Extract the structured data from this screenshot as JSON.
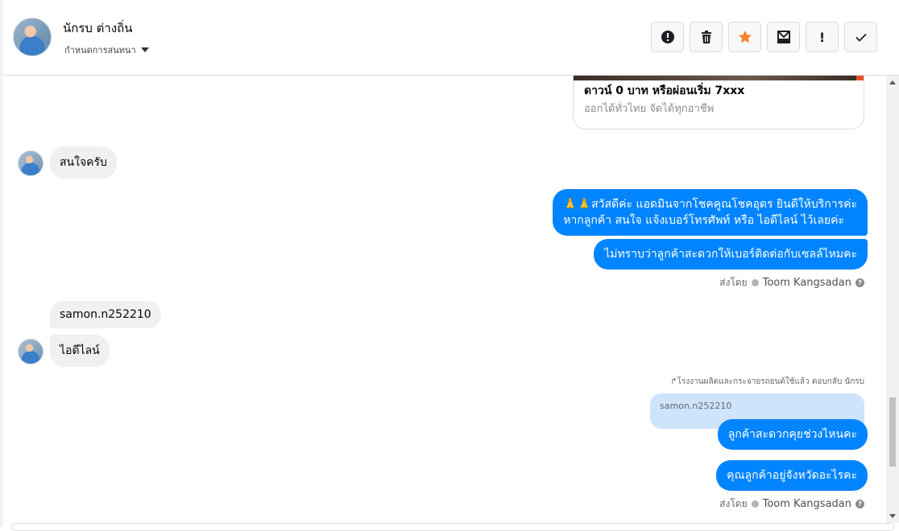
{
  "header": {
    "name": "นักรบ ต่างถิ่น",
    "assign_label": "กำหนดการสนทนา",
    "actions": [
      {
        "id": "report",
        "icon": "alert-circle-icon"
      },
      {
        "id": "delete",
        "icon": "trash-icon"
      },
      {
        "id": "star",
        "icon": "star-icon"
      },
      {
        "id": "inbox",
        "icon": "mail-box-icon"
      },
      {
        "id": "mark",
        "icon": "exclamation-icon"
      },
      {
        "id": "done",
        "icon": "check-icon"
      }
    ]
  },
  "card": {
    "title": "ดาวน์ 0 บาท หรือผ่อนเริ่ม 7xxx",
    "subtitle": "ออกได้ทั่วไทย จัดได้ทุกอาชีพ"
  },
  "messages": {
    "in1": "สนใจครับ",
    "out1_line1": "🙏🙏สวัสดีค่ะ แอดมินจากโชคคูณโชคอุดร ยินดีให้บริการค่ะ",
    "out1_line2": "หากลูกค้า สนใจ แจ้งเบอร์โทรศัพท์ หรือ ไอดีไลน์  ไว้เลยค่ะ",
    "out2": "ไม่ทราบว่าลูกค้าสะดวกให้เบอร์ติดต่อกับเซลล์ไหมคะ",
    "in2": "samon.n252210",
    "in3": "ไอดีไลน์",
    "reply_note": "โรงงานผลิตและกระจายรถยนต์ใช้แล้ว ตอบกลับ นักรบ",
    "reply_quote": "samon.n252210",
    "out3": "ลูกค้าสะดวกคุยช่วงไหนคะ",
    "out4": "คุณลูกค้าอยู่จังหวัดอะไรคะ"
  },
  "sent_by": {
    "prefix": "ส่งโดย",
    "name": "Toom Kangsadan"
  },
  "colors": {
    "outgoing": "#0084ff",
    "incoming": "#f0f0f0",
    "star": "#f5822a"
  }
}
